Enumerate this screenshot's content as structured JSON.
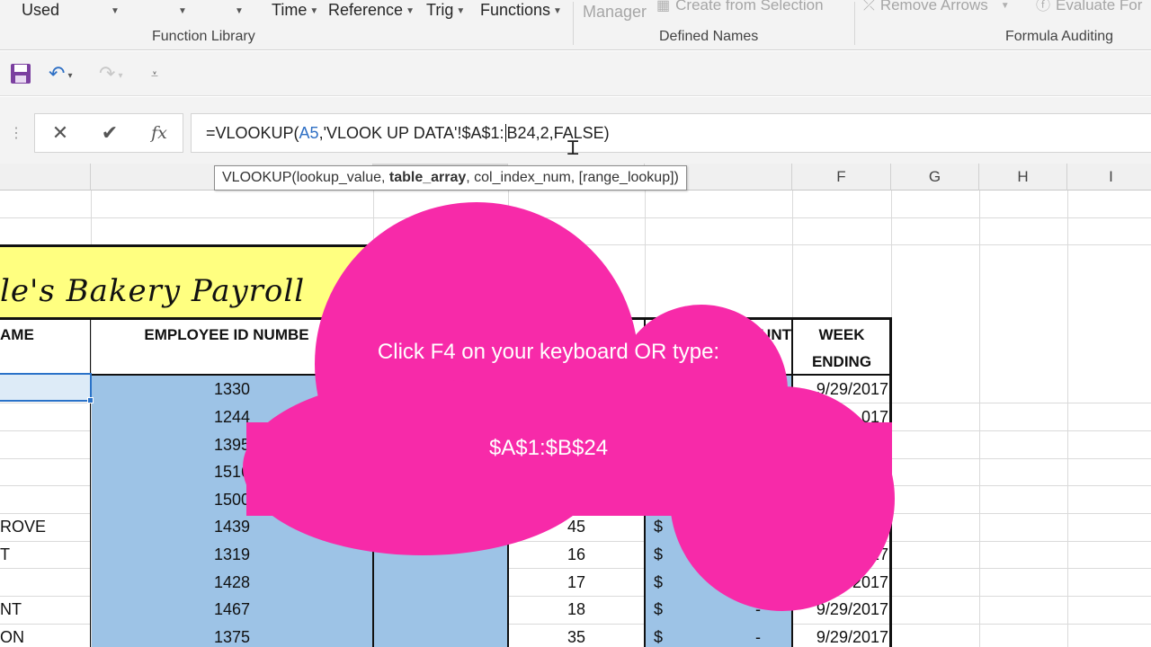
{
  "ribbon": {
    "items": [
      "Used",
      "Time",
      "Reference",
      "Trig",
      "Functions"
    ],
    "defined_names": {
      "manager": "Manager",
      "create_from_selection": "Create from Selection"
    },
    "auditing": {
      "remove_arrows": "Remove Arrows",
      "evaluate": "Evaluate For"
    },
    "groups": {
      "function_library": "Function Library",
      "defined_names": "Defined Names",
      "formula_auditing": "Formula Auditing"
    }
  },
  "formula_bar": {
    "parts": [
      "=VLOOKUP(",
      "A5",
      ",'VLOOK UP DATA'!$A$1:",
      "B24,2,FALSE)"
    ],
    "fx": "fx"
  },
  "tooltip": {
    "fn": "VLOOKUP(",
    "arg1": "lookup_value, ",
    "arg2_bold": "table_array",
    "rest": ", col_index_num, [range_lookup])"
  },
  "columns": [
    "F",
    "G",
    "H",
    "I"
  ],
  "sheet": {
    "title": "le's Bakery Payroll",
    "headers": {
      "name": "AME",
      "employee_id": "EMPLOYEE ID NUMBE",
      "amount": "UNT",
      "week_ending_1": "WEEK",
      "week_ending_2": "ENDING"
    },
    "rows": [
      {
        "name": "",
        "id": "1330",
        "hours": "",
        "dollar": "",
        "dash": "",
        "date": "9/29/2017"
      },
      {
        "name": "",
        "id": "1244",
        "hours": "",
        "dollar": "",
        "dash": "",
        "date": "017"
      },
      {
        "name": "",
        "id": "1395",
        "hours": "",
        "dollar": "",
        "dash": "",
        "date": "17"
      },
      {
        "name": "",
        "id": "1516",
        "hours": "",
        "dollar": "",
        "dash": "",
        "date": ""
      },
      {
        "name": "",
        "id": "1500",
        "hours": "",
        "dollar": "",
        "dash": "",
        "date": ""
      },
      {
        "name": "ROVE",
        "id": "1439",
        "hours": "45",
        "dollar": "$",
        "dash": "-",
        "date": "9/29/2017"
      },
      {
        "name": "T",
        "id": "1319",
        "hours": "16",
        "dollar": "$",
        "dash": "-",
        "date": "9/29/2017"
      },
      {
        "name": "",
        "id": "1428",
        "hours": "17",
        "dollar": "$",
        "dash": "-",
        "date": "9/29/2017"
      },
      {
        "name": "NT",
        "id": "1467",
        "hours": "18",
        "dollar": "$",
        "dash": "-",
        "date": "9/29/2017"
      },
      {
        "name": "ON",
        "id": "1375",
        "hours": "35",
        "dollar": "$",
        "dash": "-",
        "date": "9/29/2017"
      }
    ],
    "partial": {
      "row1_amount_tail": "0"
    }
  },
  "cloud": {
    "line1": "Click F4 on your keyboard OR type:",
    "line2": "$A$1:$B$24",
    "color": "#f72aa9"
  }
}
